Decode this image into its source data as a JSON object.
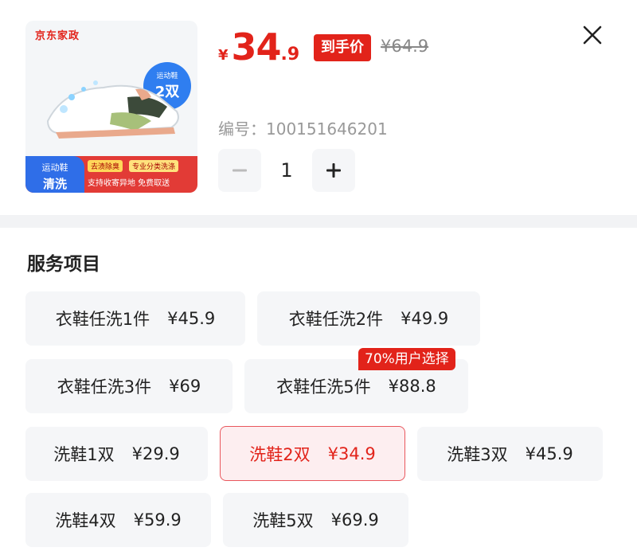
{
  "product": {
    "brand": "京东家政",
    "badge_small": "运动鞋",
    "badge_big": "2双",
    "banner_left_small": "运动鞋",
    "banner_left_big": "清洗",
    "banner_tag1": "去渍除臭",
    "banner_tag2": "专业分类洗涤",
    "banner_bottom": "支持收寄异地 免费取送",
    "price_currency": "¥",
    "price_int": "34",
    "price_dec": ".9",
    "price_tag": "到手价",
    "original_price": "¥64.9",
    "sku_label": "编号：100151646201",
    "quantity": "1"
  },
  "services": {
    "title": "服务项目",
    "hot_tag": "70%用户选择",
    "options": [
      {
        "name": "衣鞋任洗1件",
        "price": "¥45.9"
      },
      {
        "name": "衣鞋任洗2件",
        "price": "¥49.9"
      },
      {
        "name": "衣鞋任洗3件",
        "price": "¥69"
      },
      {
        "name": "衣鞋任洗5件",
        "price": "¥88.8"
      },
      {
        "name": "洗鞋1双",
        "price": "¥29.9"
      },
      {
        "name": "洗鞋2双",
        "price": "¥34.9"
      },
      {
        "name": "洗鞋3双",
        "price": "¥45.9"
      },
      {
        "name": "洗鞋4双",
        "price": "¥59.9"
      },
      {
        "name": "洗鞋5双",
        "price": "¥69.9"
      }
    ],
    "selected_index": 5
  },
  "colors": {
    "accent": "#e2231a",
    "selected_bg": "#fdeef0",
    "option_bg": "#f5f6f8"
  },
  "icons": {
    "close": "close-icon",
    "minus": "minus-icon",
    "plus": "plus-icon"
  }
}
